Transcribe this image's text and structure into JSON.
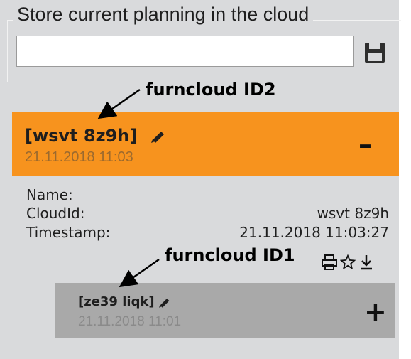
{
  "store_section": {
    "legend": "Store current planning in the cloud",
    "input_value": "",
    "save_icon": "floppy-disk-icon"
  },
  "annotations": {
    "id2": "furncloud ID2",
    "id1": "furncloud ID1"
  },
  "items": [
    {
      "id_label": "[wsvt 8z9h]",
      "timestamp": "21.11.2018 11:03",
      "toggle": "–",
      "edit_icon": "pencil-icon",
      "details": {
        "name_label": "Name:",
        "name_value": "",
        "cloudid_label": "CloudId:",
        "cloudid_value": "wsvt 8z9h",
        "timestamp_label": "Timestamp:",
        "timestamp_value": "21.11.2018 11:03:27"
      },
      "actions": [
        "print-icon",
        "star-icon",
        "download-icon"
      ]
    },
    {
      "id_label": "[ze39 liqk]",
      "timestamp": "21.11.2018 11:01",
      "toggle": "+",
      "edit_icon": "pencil-icon"
    }
  ],
  "colors": {
    "panel": "#d9dadc",
    "item_active": "#f7931e",
    "item_inactive": "#a9a9a9"
  }
}
